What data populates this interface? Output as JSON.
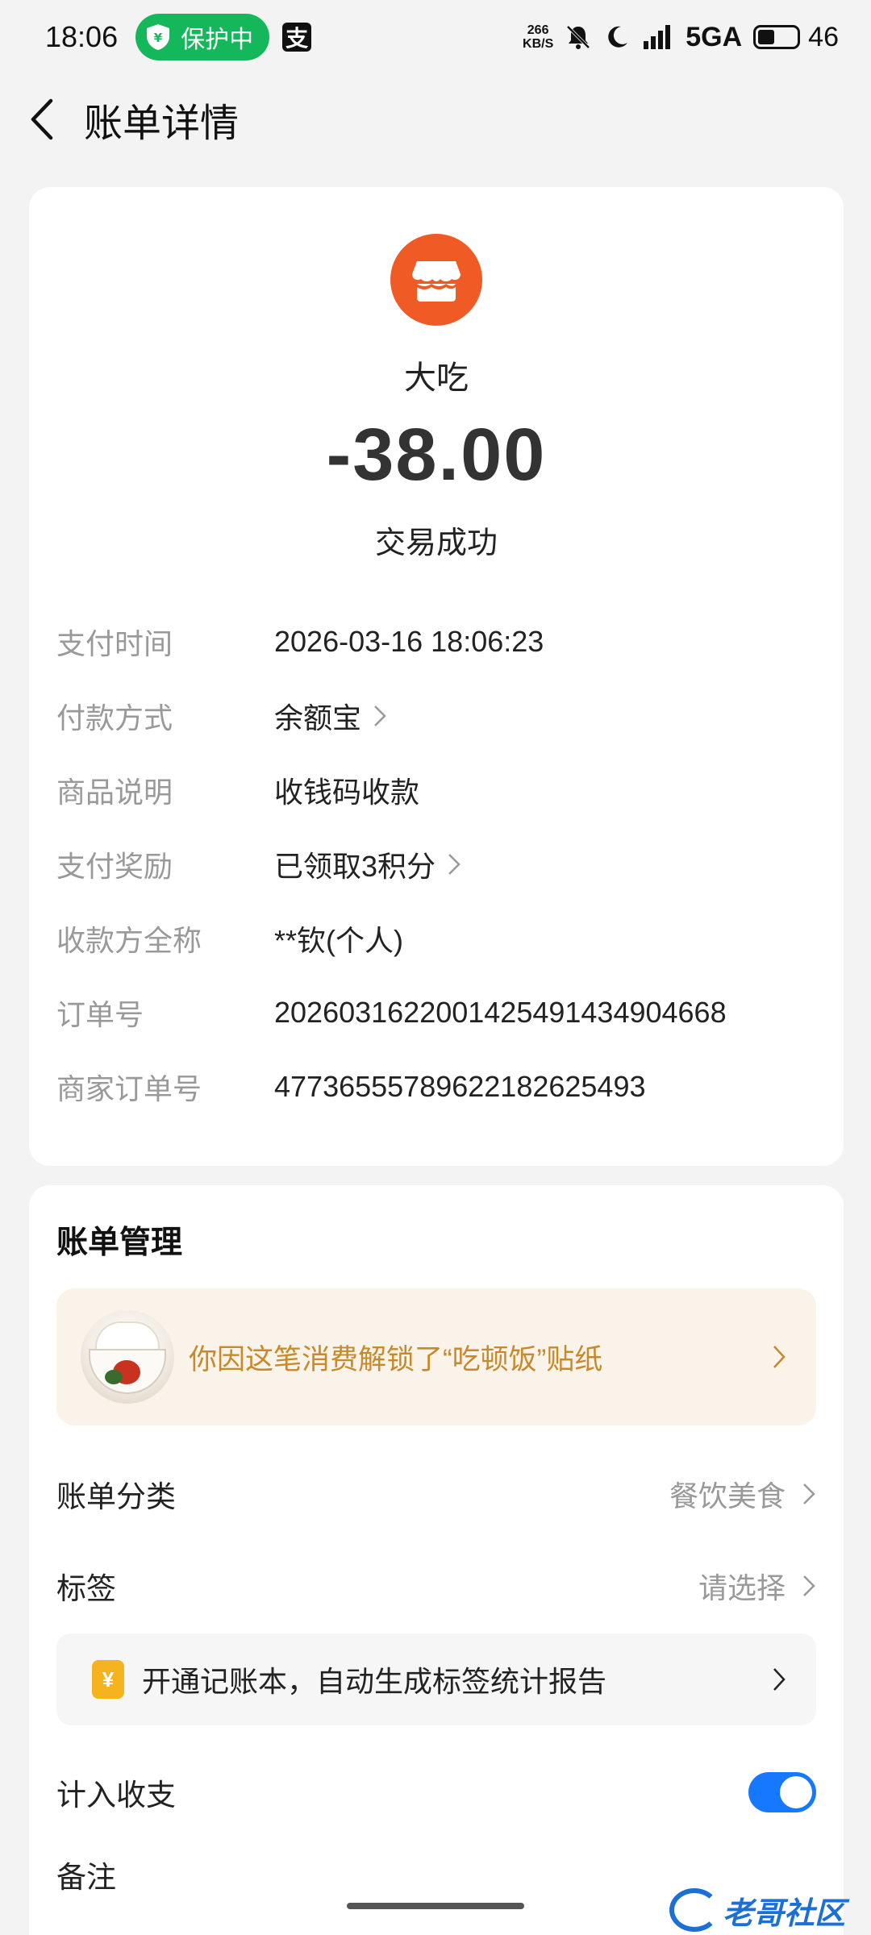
{
  "status_bar": {
    "time": "18:06",
    "protect_label": "保护中",
    "app_glyph": "支",
    "net_speed_value": "266",
    "net_speed_unit": "KB/S",
    "network": "5GA",
    "battery": "46",
    "icons": [
      "shield-icon",
      "alipay-icon",
      "mute-bell-icon",
      "moon-icon",
      "signal-icon",
      "battery-icon"
    ]
  },
  "header": {
    "title": "账单详情",
    "back_icon": "back-arrow-icon"
  },
  "summary": {
    "merchant_name": "大吃",
    "amount": "-38.00",
    "status": "交易成功",
    "logo_icon": "shop-icon",
    "logo_color": "#f05a24"
  },
  "details": [
    {
      "label": "支付时间",
      "value": "2026-03-16 18:06:23",
      "link": false
    },
    {
      "label": "付款方式",
      "value": "余额宝",
      "link": true
    },
    {
      "label": "商品说明",
      "value": "收钱码收款",
      "link": false
    },
    {
      "label": "支付奖励",
      "value": "已领取3积分",
      "link": true
    },
    {
      "label": "收款方全称",
      "value": "**钦(个人)",
      "link": false
    },
    {
      "label": "订单号",
      "value": "2026031622001425491434904668",
      "link": false
    },
    {
      "label": "商家订单号",
      "value": "4773655578962218262549​3",
      "link": false
    }
  ],
  "management": {
    "title": "账单管理",
    "sticker_text": "你因这笔消费解锁了“吃顿饭”贴纸",
    "category_label": "账单分类",
    "category_value": "餐饮美食",
    "tag_label": "标签",
    "tag_value": "请选择",
    "ledger_icon_glyph": "¥",
    "ledger_text": "开通记账本，自动生成标签统计报告",
    "count_label": "计入收支",
    "count_enabled": true,
    "remark_label": "备注"
  },
  "watermark": {
    "text": "老哥社区"
  },
  "colors": {
    "accent_blue": "#1677ff",
    "sticker_text": "#c8892b",
    "protect_green": "#14b85a"
  }
}
